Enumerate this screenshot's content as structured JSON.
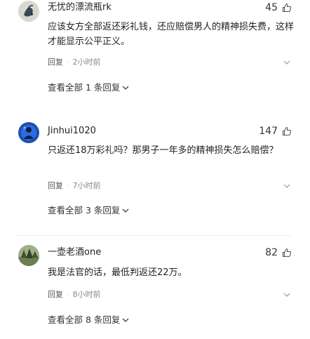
{
  "comments": [
    {
      "username": "无忧的漂流瓶rk",
      "likes": "45",
      "text": "应该女方全部返还彩礼钱，还应赔偿男人的精神损失费，这样才能显示公平正义。",
      "reply_label": "回复",
      "separator": "·",
      "time": "2小时前",
      "view_all": "查看全部 1 条回复",
      "avatar_icon": "ink-painting-avatar",
      "colors": {
        "avatar_bg": "#d8d8d0"
      }
    },
    {
      "username": "Jinhui1020",
      "likes": "147",
      "text": "只返还18万彩礼吗？那男子一年多的精神损失怎么赔偿？",
      "reply_label": "回复",
      "separator": "·",
      "time": "7小时前",
      "view_all": "查看全部 3 条回复",
      "avatar_icon": "blue-silhouette-avatar",
      "colors": {
        "avatar_bg": "#1c4fb0"
      }
    },
    {
      "username": "一壶老酒one",
      "likes": "82",
      "text": "我是法官的话，最低判返还22万。",
      "reply_label": "回复",
      "separator": "·",
      "time": "8小时前",
      "view_all": "查看全部 8 条回复",
      "avatar_icon": "landscape-avatar",
      "colors": {
        "avatar_bg": "#6b7d52"
      }
    }
  ],
  "icons": {
    "like": "thumbs-up-icon",
    "more": "chevron-down-icon",
    "expand": "chevron-down-icon"
  }
}
